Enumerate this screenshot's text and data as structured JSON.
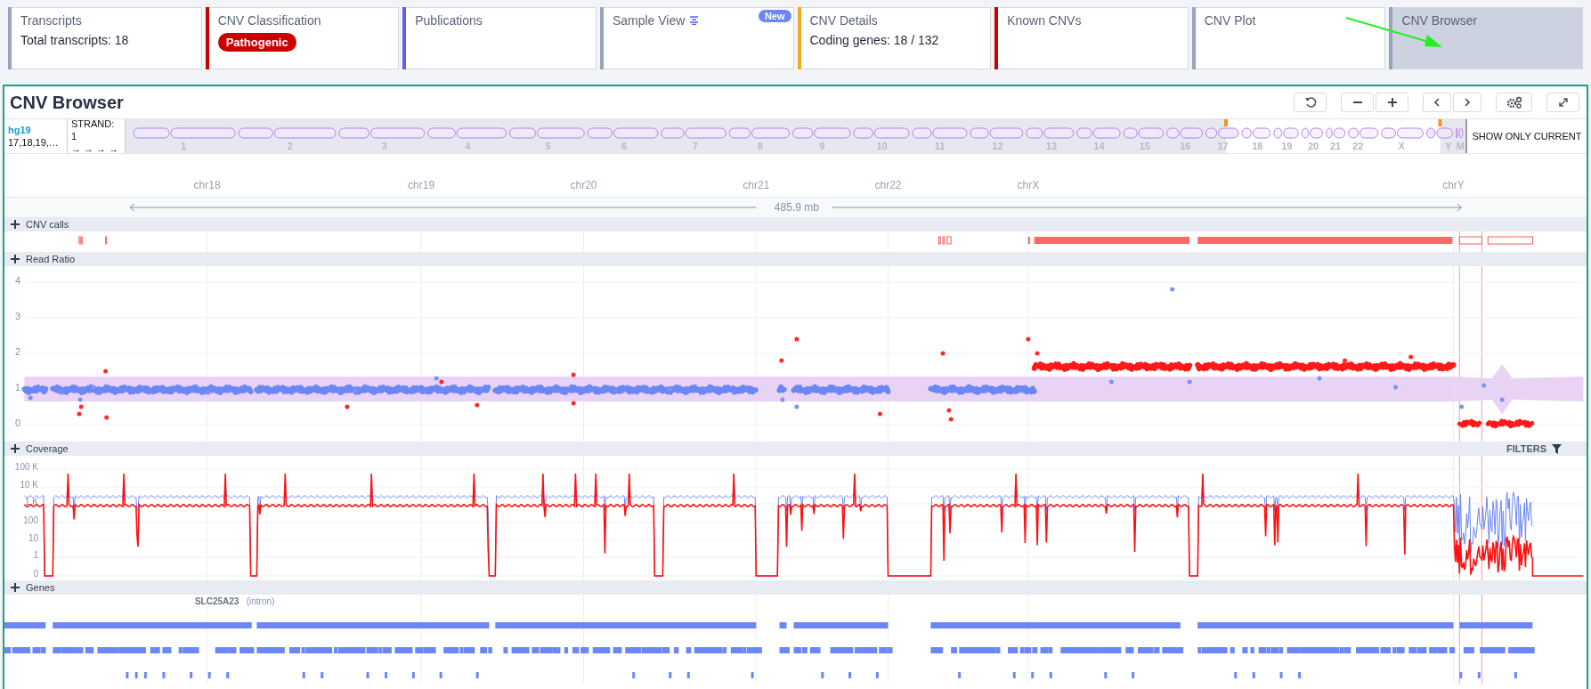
{
  "cards": [
    {
      "title": "Transcripts",
      "kind": "text",
      "value": "Total transcripts:  18",
      "color": "#9aa3bd",
      "selected": false
    },
    {
      "title": "CNV Classification",
      "kind": "badge",
      "value": "Pathogenic",
      "color": "#cc0000",
      "selected": false
    },
    {
      "title": "Publications",
      "kind": "none",
      "color": "#5a5ff0",
      "selected": false
    },
    {
      "title": "Sample View",
      "kind": "new",
      "badge": "New",
      "color": "#9aa3bd",
      "selected": false
    },
    {
      "title": "CNV Details",
      "kind": "text",
      "value": "Coding genes: 18 / 132",
      "color": "#f5a623",
      "selected": false
    },
    {
      "title": "Known CNVs",
      "kind": "none",
      "color": "#cc0000",
      "selected": false
    },
    {
      "title": "CNV Plot",
      "kind": "none",
      "color": "#9aa3bd",
      "selected": false
    },
    {
      "title": "CNV Browser",
      "kind": "none",
      "color": "#9aa3bd",
      "selected": true
    }
  ],
  "panel": {
    "title": "CNV Browser"
  },
  "genome": {
    "build": "hg19",
    "chromosomes_shown": "17,18,19,…",
    "strand_label": "STRAND:",
    "strand": "1",
    "strand_arrows": "→ → → →"
  },
  "ideogram": {
    "chromosomes": [
      "1",
      "2",
      "3",
      "4",
      "5",
      "6",
      "7",
      "8",
      "9",
      "10",
      "11",
      "12",
      "13",
      "14",
      "15",
      "16",
      "17",
      "18",
      "19",
      "20",
      "21",
      "22",
      "X",
      "Y",
      "M"
    ]
  },
  "show_only_current": "SHOW ONLY CURRENT",
  "axis": {
    "labels": [
      "chr18",
      "chr19",
      "chr20",
      "chr21",
      "chr22",
      "chrX",
      "chrY"
    ],
    "span": "485.9 mb"
  },
  "tracks": [
    {
      "kind": "calls",
      "title": "CNV calls"
    },
    {
      "kind": "ratio",
      "title": "Read Ratio",
      "y_ticks": [
        "4",
        "3",
        "2",
        "1",
        "0"
      ]
    },
    {
      "kind": "coverage",
      "title": "Coverage",
      "y_ticks": [
        "100 K",
        "10 K",
        "1 K",
        "100",
        "10",
        "1",
        "0"
      ],
      "filters": "FILTERS"
    },
    {
      "kind": "genes",
      "title": "Genes",
      "gene": "SLC25A23",
      "note": "(intron)"
    }
  ]
}
